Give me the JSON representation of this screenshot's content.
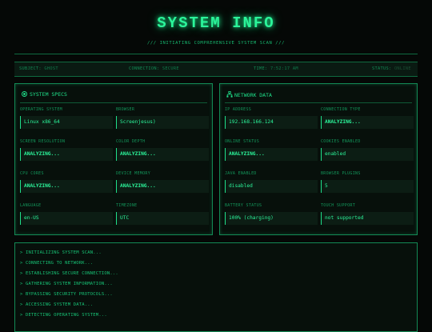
{
  "header": {
    "title": "SYSTEM INFO",
    "subtitle": "/// INITIATING COMPREHENSIVE SYSTEM SCAN ///"
  },
  "statusbar": {
    "subject_label": "SUBJECT:",
    "subject_value": "GHOST",
    "connection_label": "CONNECTION:",
    "connection_value": "SECURE",
    "time_label": "TIME:",
    "time_value": "7:52:17 AM",
    "status_label": "STATUS:",
    "status_value": "ONLINE"
  },
  "specs": {
    "title": "SYSTEM SPECS",
    "icon": "cpu-icon",
    "fields": [
      {
        "label": "OPERATING SYSTEM",
        "value": "Linux x86_64"
      },
      {
        "label": "BROWSER",
        "value": "Screenjesus)"
      },
      {
        "label": "SCREEN RESOLUTION",
        "value": "ANALYZING..."
      },
      {
        "label": "COLOR DEPTH",
        "value": "ANALYZING..."
      },
      {
        "label": "CPU CORES",
        "value": "ANALYZING..."
      },
      {
        "label": "DEVICE MEMORY",
        "value": "ANALYZING..."
      },
      {
        "label": "LANGUAGE",
        "value": "en-US"
      },
      {
        "label": "TIMEZONE",
        "value": "UTC"
      }
    ]
  },
  "network": {
    "title": "NETWORK DATA",
    "icon": "network-icon",
    "fields": [
      {
        "label": "IP ADDRESS",
        "value": "192.168.166.124"
      },
      {
        "label": "CONNECTION TYPE",
        "value": "ANALYZING..."
      },
      {
        "label": "ONLINE STATUS",
        "value": "ANALYZING..."
      },
      {
        "label": "COOKIES ENABLED",
        "value": "enabled"
      },
      {
        "label": "JAVA ENABLED",
        "value": "disabled"
      },
      {
        "label": "BROWSER PLUGINS",
        "value": "5"
      },
      {
        "label": "BATTERY STATUS",
        "value": "100% (charging)"
      },
      {
        "label": "TOUCH SUPPORT",
        "value": "not supported"
      }
    ]
  },
  "log": [
    "> INITIALIZING SYSTEM SCAN...",
    "> CONNECTING TO NETWORK...",
    "> ESTABLISHING SECURE CONNECTION...",
    "> GATHERING SYSTEM INFORMATION...",
    "> BYPASSING SECURITY PROTOCOLS...",
    "> ACCESSING SYSTEM DATA...",
    "> DETECTING OPERATING SYSTEM..."
  ],
  "colors": {
    "accent": "#1fe08a",
    "background": "#050806",
    "panel_border": "#138a55"
  }
}
